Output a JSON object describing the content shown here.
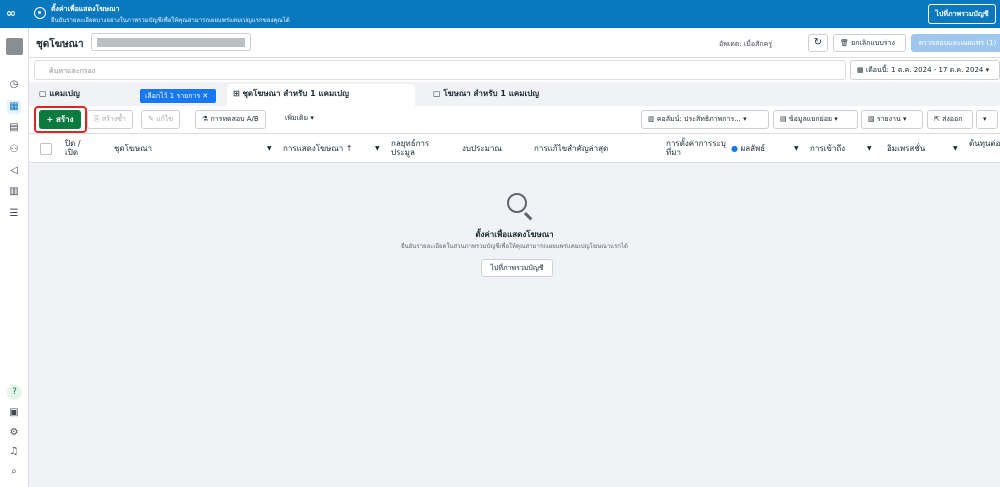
{
  "banner": {
    "title": "ตั้งค่าเพื่อแสดงโฆษณา",
    "subtitle": "ยืนยันรายละเอียดบางอย่างในภาพรวมบัญชีเพื่อให้คุณสามารถเผยแพร่แคมเปญแรกของคุณได้",
    "button": "ไปที่ภาพรวมบัญชี"
  },
  "header": {
    "title": "ชุดโฆษณา",
    "updated": "อัพเดต: เมื่อสักครู่",
    "discard": "ยกเลิกแบบร่าง",
    "review": "ตรวจสอบและเผยแพร่ (1)",
    "more": "···"
  },
  "search": {
    "placeholder": "ค้นหาและกรอง"
  },
  "date_range": "เดือนนี้: 1 ต.ค. 2024 - 17 ต.ค. 2024",
  "tabs": {
    "campaigns": "แคมเปญ",
    "selected_chip": "เลือกไว้ 1 รายการ",
    "adsets": "ชุดโฆษณา สำหรับ 1 แคมเปญ",
    "ads": "โฆษณา สำหรับ 1 แคมเปญ"
  },
  "toolbar": {
    "create": "สร้าง",
    "duplicate": "สร้างซ้ำ",
    "edit": "แก้ไข",
    "ab_test": "การทดสอบ A/B",
    "more": "เพิ่มเติม",
    "columns": "คอลัมน์: ประสิทธิภาพการ...",
    "breakdown": "ข้อมูลแยกย่อย",
    "reports": "รายงาน",
    "export": "ส่งออก"
  },
  "columns": [
    "ปิด / เปิด",
    "ชุดโฆษณา",
    "การแสดงโฆษณา ↑",
    "กลยุทธ์การประมูล",
    "งบประมาณ",
    "การแก้ไขสำคัญล่าสุด",
    "การตั้งค่าการระบุที่มา",
    "ผลลัพธ์",
    "การเข้าถึง",
    "อิมเพรสชั่น",
    "ต้นทุนต่อผลลัพธ์"
  ],
  "empty": {
    "title": "ตั้งค่าเพื่อแสดงโฆษณา",
    "subtitle": "ยืนยันรายละเอียดในส่วนภาพรวมบัญชีเพื่อให้คุณสามารถเผยแพร่แคมเปญโฆษณาแรกได้",
    "button": "ไปที่ภาพรวมบัญชี"
  },
  "icons": [
    "meta-icon",
    "eye-icon",
    "home-icon",
    "table-icon",
    "book-icon",
    "audience-icon",
    "megaphone-icon",
    "report-icon",
    "menu-icon",
    "help-icon",
    "inbox-icon",
    "gear-icon",
    "bell-icon",
    "search-icon"
  ]
}
